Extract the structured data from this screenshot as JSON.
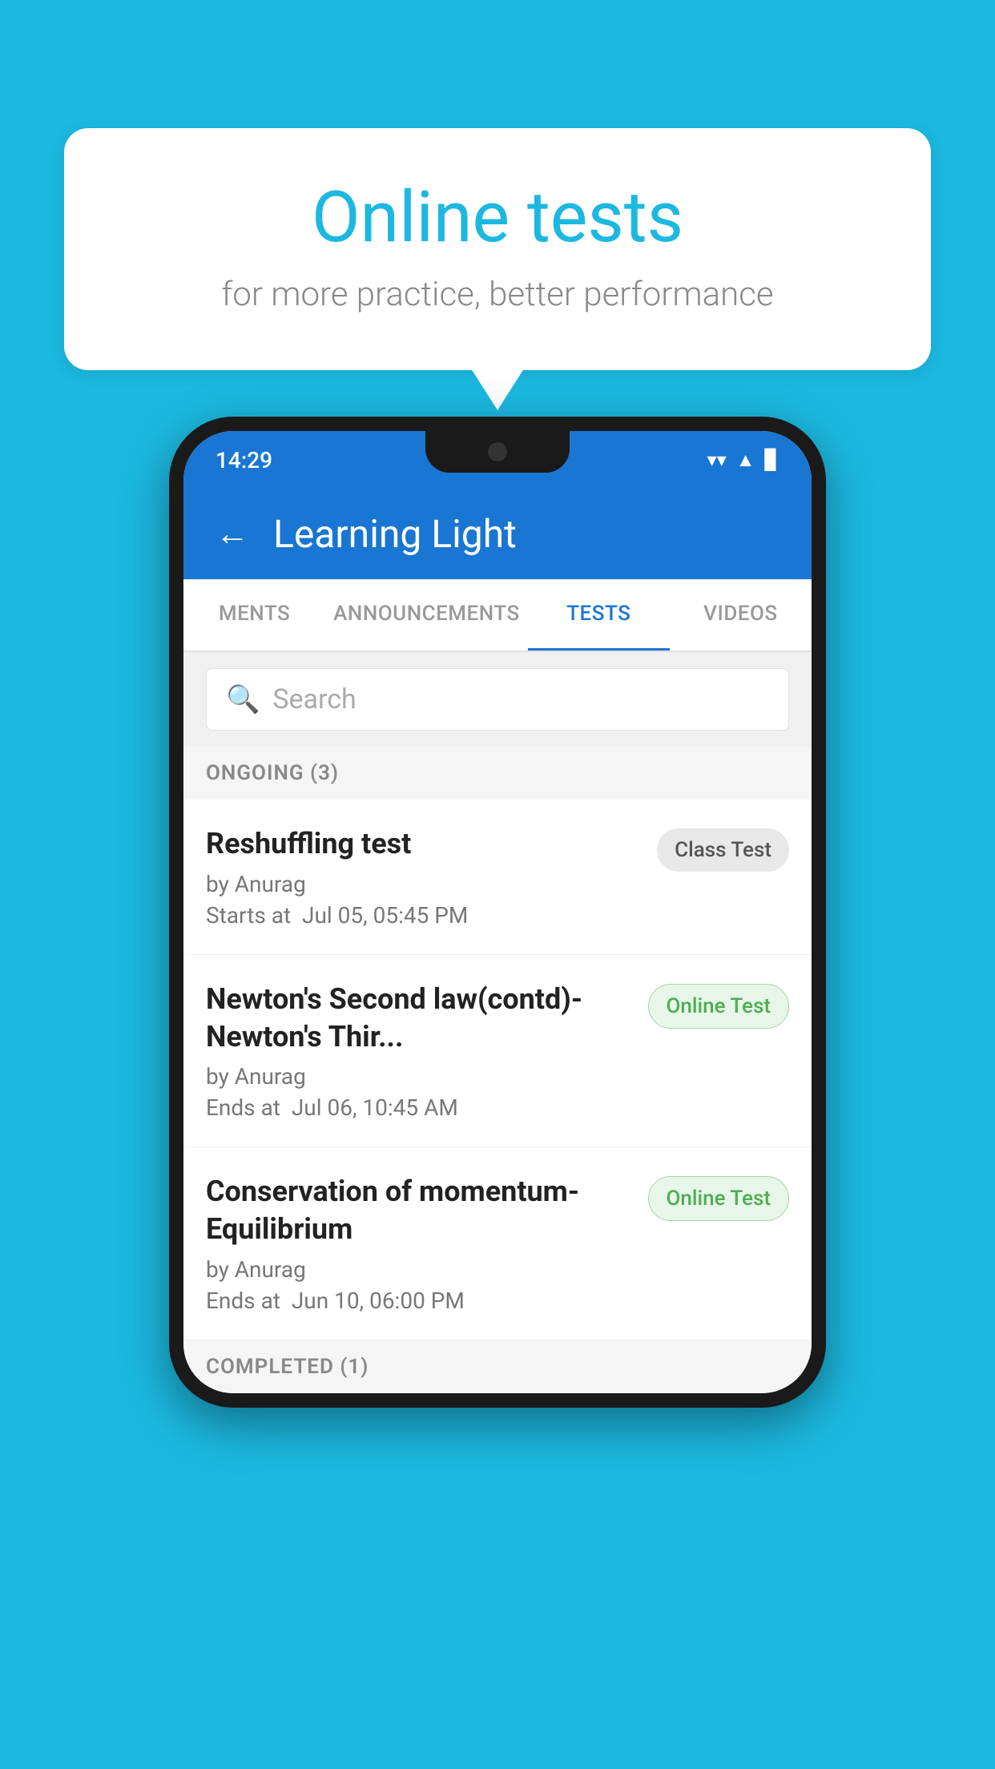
{
  "background_color": "#1cb8e0",
  "speech_bubble": {
    "title": "Online tests",
    "subtitle": "for more practice, better performance"
  },
  "phone": {
    "status_bar": {
      "time": "14:29",
      "wifi": "▼",
      "signal": "▲",
      "battery": "▐"
    },
    "header": {
      "back_label": "←",
      "title": "Learning Light"
    },
    "tabs": [
      {
        "label": "MENTS",
        "active": false
      },
      {
        "label": "ANNOUNCEMENTS",
        "active": false
      },
      {
        "label": "TESTS",
        "active": true
      },
      {
        "label": "VIDEOS",
        "active": false
      }
    ],
    "search": {
      "placeholder": "Search"
    },
    "ongoing_section": {
      "title": "ONGOING (3)"
    },
    "tests": [
      {
        "name": "Reshuffling test",
        "author": "by Anurag",
        "time_label": "Starts at",
        "time": "Jul 05, 05:45 PM",
        "badge": "Class Test",
        "badge_type": "class"
      },
      {
        "name": "Newton's Second law(contd)-Newton's Thir...",
        "author": "by Anurag",
        "time_label": "Ends at",
        "time": "Jul 06, 10:45 AM",
        "badge": "Online Test",
        "badge_type": "online"
      },
      {
        "name": "Conservation of momentum-Equilibrium",
        "author": "by Anurag",
        "time_label": "Ends at",
        "time": "Jun 10, 06:00 PM",
        "badge": "Online Test",
        "badge_type": "online"
      }
    ],
    "completed_section": {
      "title": "COMPLETED (1)"
    }
  }
}
